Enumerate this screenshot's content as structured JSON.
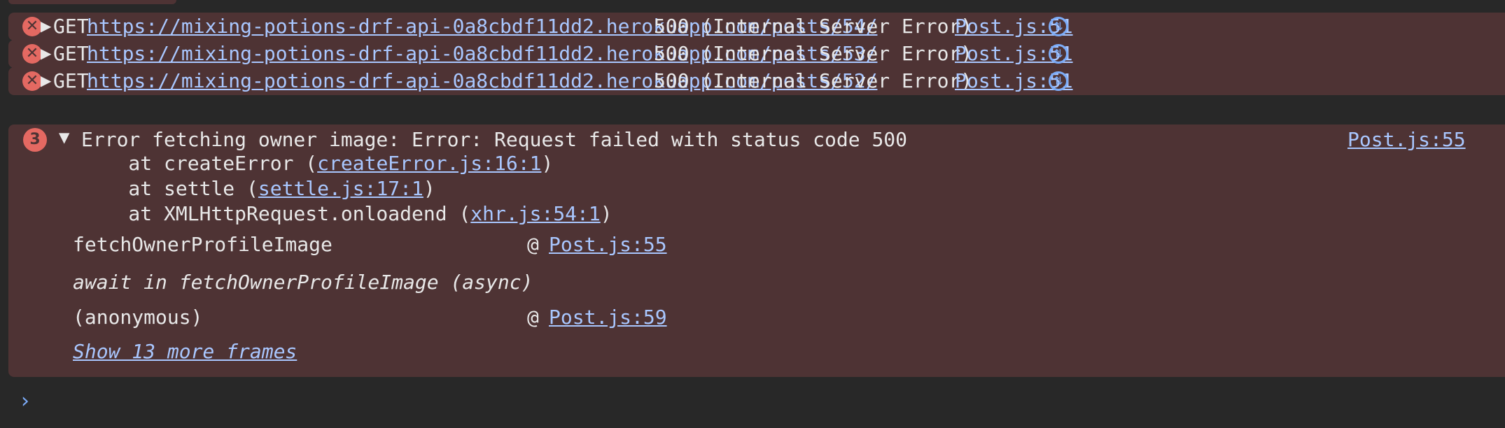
{
  "network_errors": [
    {
      "method": "GET",
      "url": "https://mixing-potions-drf-api-0a8cbdf11dd2.herokuapp.com/posts/54/",
      "status": "500 (Internal Server Error)",
      "source": "Post.js:51"
    },
    {
      "method": "GET",
      "url": "https://mixing-potions-drf-api-0a8cbdf11dd2.herokuapp.com/posts/53/",
      "status": "500 (Internal Server Error)",
      "source": "Post.js:51"
    },
    {
      "method": "GET",
      "url": "https://mixing-potions-drf-api-0a8cbdf11dd2.herokuapp.com/posts/52/",
      "status": "500 (Internal Server Error)",
      "source": "Post.js:51"
    }
  ],
  "grouped_error": {
    "count": "3",
    "message": "Error fetching owner image: Error: Request failed with status code 500",
    "source": "Post.js:55",
    "stack": [
      {
        "prefix": "    at createError (",
        "link": "createError.js:16:1",
        "suffix": ")"
      },
      {
        "prefix": "    at settle (",
        "link": "settle.js:17:1",
        "suffix": ")"
      },
      {
        "prefix": "    at XMLHttpRequest.onloadend (",
        "link": "xhr.js:54:1",
        "suffix": ")"
      }
    ],
    "frames": [
      {
        "name": "fetchOwnerProfileImage",
        "at": "@",
        "link": "Post.js:55"
      },
      {
        "async": "await in fetchOwnerProfileImage (async)"
      },
      {
        "name": "(anonymous)",
        "at": "@",
        "link": "Post.js:59"
      }
    ],
    "show_more": "Show 13 more frames"
  },
  "colors": {
    "error_row_bg": "#4e3334",
    "console_bg": "#282828",
    "link": "#a9c7ff",
    "error_icon": "#e46962"
  }
}
